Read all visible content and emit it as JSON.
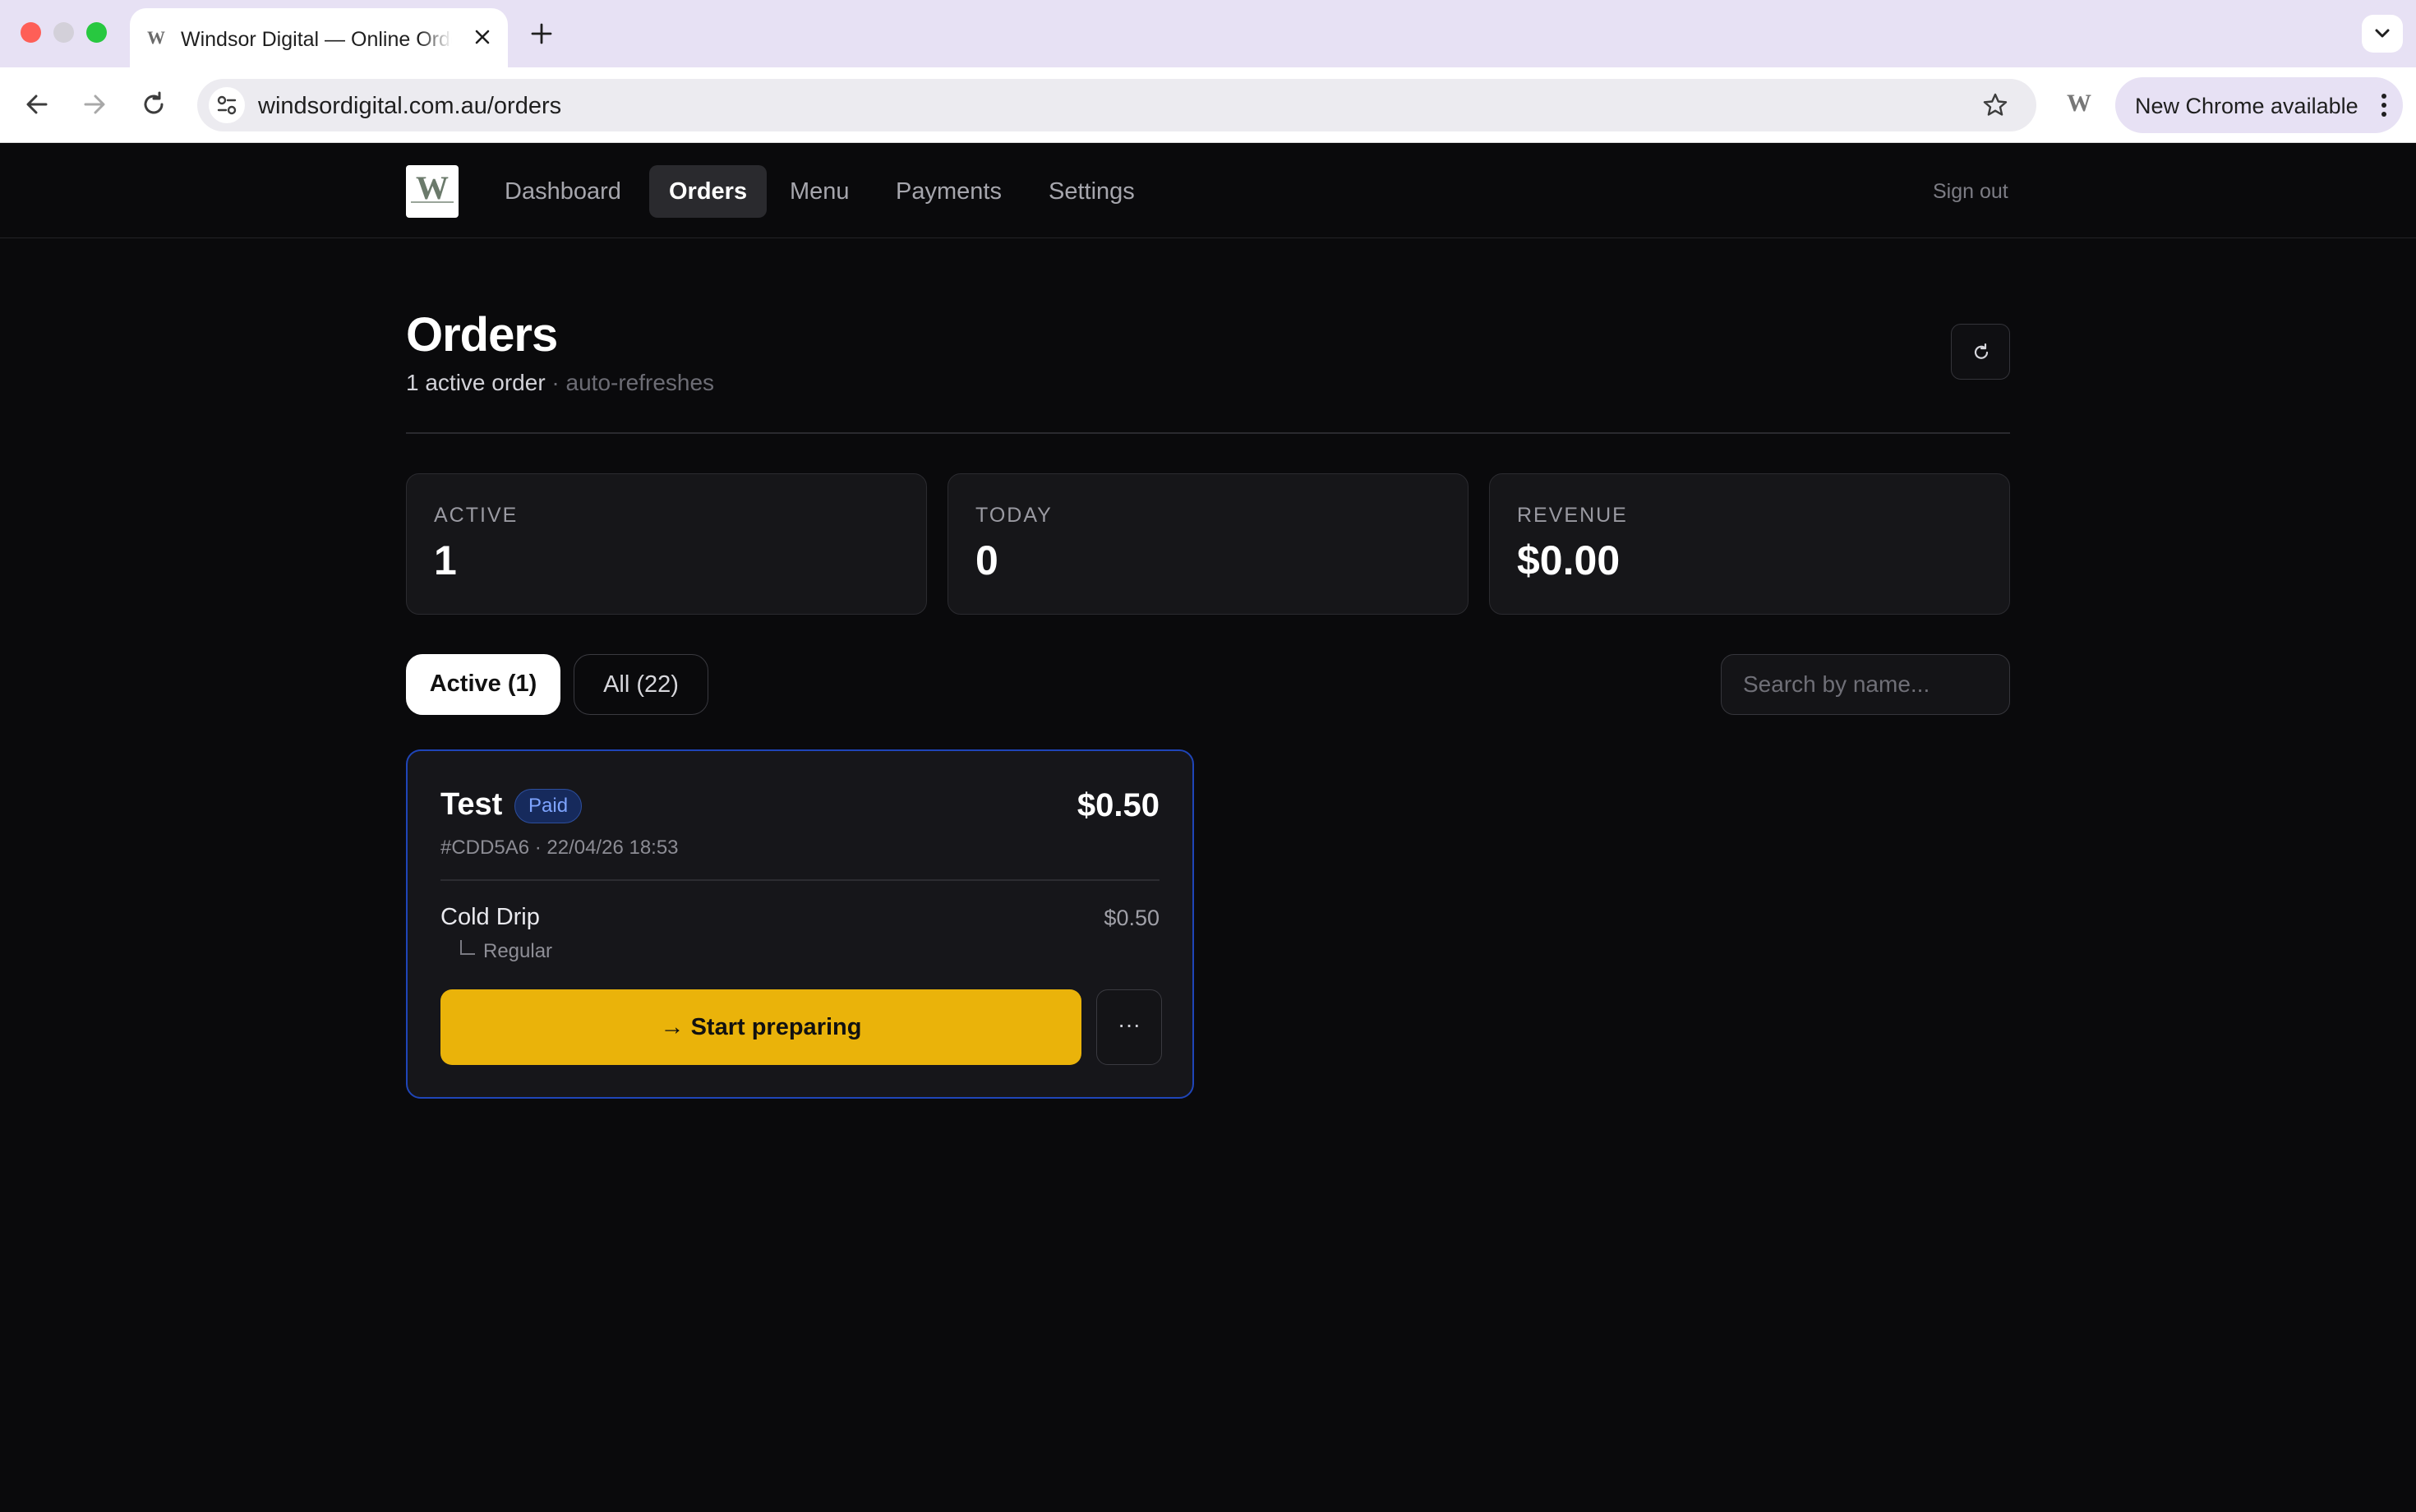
{
  "browser": {
    "tab_title": "Windsor Digital — Online Orders",
    "url": "windsordigital.com.au/orders",
    "update_label": "New Chrome available",
    "favicon_letter": "W"
  },
  "nav": {
    "logo_letter": "W",
    "items": [
      "Dashboard",
      "Orders",
      "Menu",
      "Payments",
      "Settings"
    ],
    "active": "Orders",
    "sign_out": "Sign out"
  },
  "page": {
    "title": "Orders",
    "summary": "1 active order",
    "auto_refresh_note": " · auto-refreshes"
  },
  "stats": [
    {
      "label": "ACTIVE",
      "value": "1"
    },
    {
      "label": "TODAY",
      "value": "0"
    },
    {
      "label": "REVENUE",
      "value": "$0.00"
    }
  ],
  "filters": {
    "active_label": "Active (1)",
    "all_label": "All (22)",
    "selected": "active"
  },
  "search": {
    "placeholder": "Search by name...",
    "value": ""
  },
  "orders": [
    {
      "name": "Test",
      "status": "Paid",
      "total": "$0.50",
      "meta": "#CDD5A6 · 22/04/26 18:53",
      "items": [
        {
          "name": "Cold Drip",
          "price": "$0.50",
          "modifier": "Regular"
        }
      ],
      "primary_action": "→ Start preparing",
      "more_label": "···"
    }
  ],
  "colors": {
    "background": "#0a0a0c",
    "accent_button": "#eab30a",
    "card_border_selected": "#1f45b8",
    "badge_paid": "#7ea4ff"
  }
}
